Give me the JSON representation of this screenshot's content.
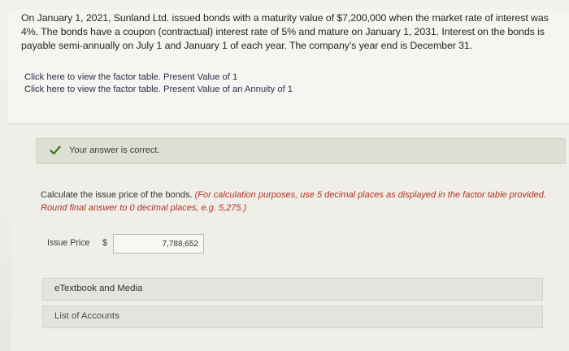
{
  "question": {
    "text": "On January 1, 2021, Sunland Ltd. issued bonds with a maturity value of $7,200,000 when the market rate of interest was 4%. The bonds have a coupon (contractual) interest rate of 5% and mature on January 1, 2031. Interest on the bonds is payable semi-annually on July 1 and January 1 of each year. The company's year end is December 31.",
    "links": [
      "Click here to view the factor table. Present Value of 1",
      "Click here to view the factor table. Present Value of an Annuity of 1"
    ]
  },
  "answer": {
    "status_text": "Your answer is correct.",
    "status_color": "#3e7d1a",
    "instruction": "Calculate the issue price of the bonds.",
    "instruction_note": "(For calculation purposes, use 5 decimal places as displayed in the factor table provided. Round final answer to 0 decimal places, e.g. 5,275.)",
    "note_color": "#b2331e",
    "issue_price_label": "Issue Price",
    "currency_symbol": "$",
    "issue_price_value": "7,788,652"
  },
  "resources": {
    "etextbook_label": "eTextbook and Media",
    "accounts_label": "List of Accounts"
  }
}
